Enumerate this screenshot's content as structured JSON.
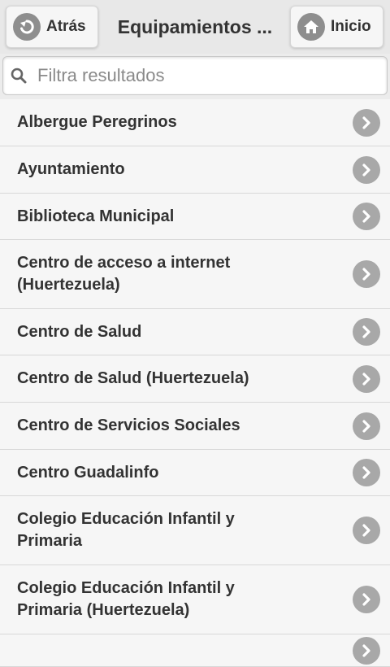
{
  "header": {
    "back_label": "Atrás",
    "title": "Equipamientos ...",
    "home_label": "Inicio"
  },
  "search": {
    "placeholder": "Filtra resultados",
    "value": ""
  },
  "items": [
    {
      "label": "Albergue Peregrinos"
    },
    {
      "label": "Ayuntamiento"
    },
    {
      "label": "Biblioteca Municipal"
    },
    {
      "label": "Centro de acceso a internet (Huertezuela)"
    },
    {
      "label": "Centro de Salud"
    },
    {
      "label": "Centro de Salud (Huertezuela)"
    },
    {
      "label": "Centro de Servicios Sociales"
    },
    {
      "label": "Centro Guadalinfo"
    },
    {
      "label": "Colegio Educación Infantil y Primaria"
    },
    {
      "label": "Colegio Educación Infantil y Primaria (Huertezuela)"
    },
    {
      "label": ""
    }
  ],
  "colors": {
    "header_bg": "#e8e8e8",
    "icon_circle": "#8e8e8e",
    "chevron_circle": "#a8a8a8",
    "text": "#333333"
  }
}
